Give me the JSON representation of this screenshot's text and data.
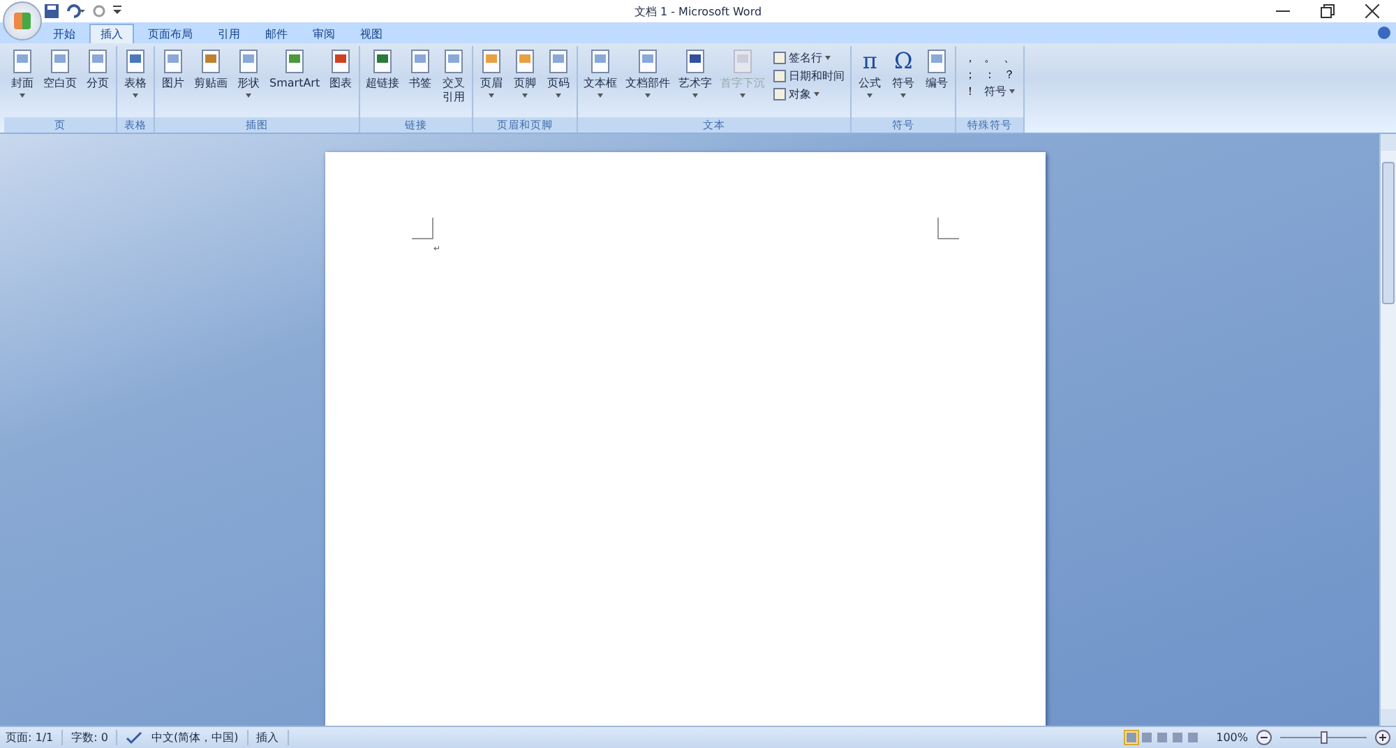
{
  "window": {
    "title": "文档 1 - Microsoft Word"
  },
  "tabs": [
    {
      "label": "开始",
      "selected": false
    },
    {
      "label": "插入",
      "selected": true
    },
    {
      "label": "页面布局",
      "selected": false
    },
    {
      "label": "引用",
      "selected": false
    },
    {
      "label": "邮件",
      "selected": false
    },
    {
      "label": "审阅",
      "selected": false
    },
    {
      "label": "视图",
      "selected": false
    }
  ],
  "ribbon_groups": [
    {
      "label": "页",
      "buttons": [
        {
          "label": "封面",
          "dropdown": true
        },
        {
          "label": "空白页",
          "dropdown": false
        },
        {
          "label": "分页",
          "dropdown": false
        }
      ]
    },
    {
      "label": "表格",
      "buttons": [
        {
          "label": "表格",
          "dropdown": true
        }
      ]
    },
    {
      "label": "插图",
      "buttons": [
        {
          "label": "图片",
          "dropdown": false
        },
        {
          "label": "剪贴画",
          "dropdown": false
        },
        {
          "label": "形状",
          "dropdown": true
        },
        {
          "label": "SmartArt",
          "dropdown": false
        },
        {
          "label": "图表",
          "dropdown": false
        }
      ]
    },
    {
      "label": "链接",
      "buttons": [
        {
          "label": "超链接",
          "dropdown": false
        },
        {
          "label": "书签",
          "dropdown": false
        },
        {
          "label": [
            "交叉",
            "引用"
          ],
          "dropdown": false
        }
      ]
    },
    {
      "label": "页眉和页脚",
      "buttons": [
        {
          "label": "页眉",
          "dropdown": true
        },
        {
          "label": "页脚",
          "dropdown": true
        },
        {
          "label": "页码",
          "dropdown": true
        }
      ]
    },
    {
      "label": "文本",
      "buttons": [
        {
          "label": "文本框",
          "dropdown": true
        },
        {
          "label": "文档部件",
          "dropdown": true
        },
        {
          "label": "艺术字",
          "dropdown": true
        },
        {
          "label": "首字下沉",
          "dropdown": true,
          "disabled": true
        }
      ],
      "small_buttons": [
        {
          "label": "签名行",
          "dropdown": true
        },
        {
          "label": "日期和时间",
          "dropdown": false
        },
        {
          "label": "对象",
          "dropdown": true
        }
      ]
    },
    {
      "label": "符号",
      "buttons": [
        {
          "label": "公式",
          "dropdown": true,
          "glyph": "π"
        },
        {
          "label": "符号",
          "dropdown": true,
          "glyph": "Ω"
        },
        {
          "label": "编号",
          "dropdown": false
        }
      ]
    },
    {
      "label": "特殊符号",
      "symbols": [
        "，",
        "。",
        "、",
        "；",
        "：",
        "？",
        "！"
      ],
      "more": {
        "label": "符号",
        "dropdown": true
      }
    }
  ],
  "document": {
    "paragraph_mark": "↵"
  },
  "status_bar": {
    "page": "页面: 1/1",
    "words": "字数: 0",
    "language": "中文(简体，中国)",
    "mode": "插入",
    "views": [
      {
        "selected": true
      },
      {
        "selected": false
      },
      {
        "selected": false
      },
      {
        "selected": false
      },
      {
        "selected": false
      }
    ],
    "zoom": "100%",
    "zoom_slider": {
      "level": 0.5
    }
  }
}
